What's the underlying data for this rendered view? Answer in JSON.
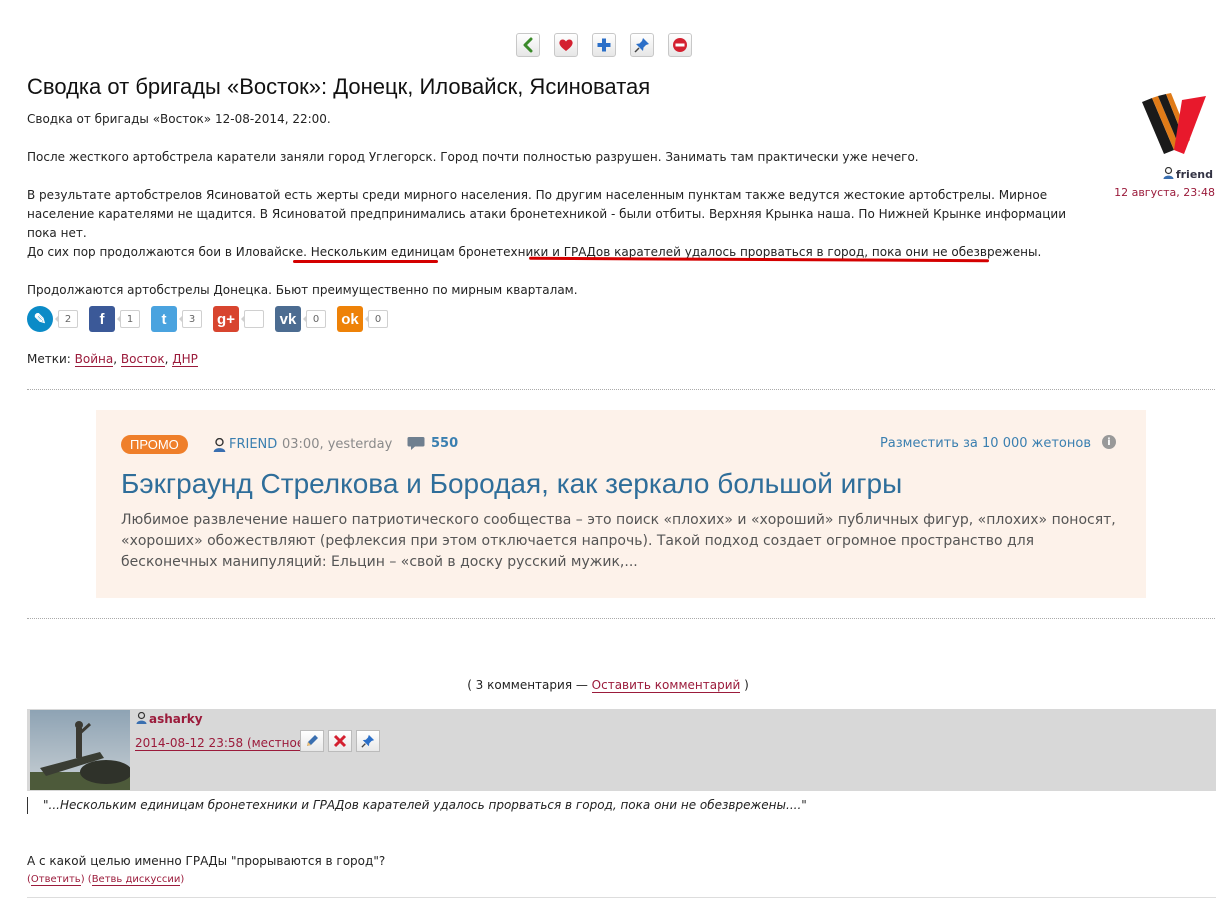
{
  "toolbar": {
    "colors": {
      "back": "#3a8a2a",
      "like": "#d42030",
      "add": "#2b6fc8",
      "pin": "#2b6fc8",
      "remove": "#d42030"
    }
  },
  "post": {
    "title": "Сводка от бригады «Восток»: Донецк, Иловайск, Ясиноватая",
    "lead": "Сводка от бригады «Восток» 12-08-2014, 22:00.",
    "p1": "После жесткого артобстрела каратели заняли город Углегорск. Город почти полностью разрушен. Занимать там практически уже нечего.",
    "p2": "В результате артобстрелов Ясиноватой есть жерты среди мирного населения. По другим населенным пунктам также ведутся жестокие артобстрелы. Мирное население карателями не щадится. В Ясиноватой предпринимались атаки бронетехникой - были отбиты. Верхняя Крынка наша. По Нижней Крынке информации пока нет.",
    "p3_a": "До сих пор продолжаются бои в Иловайске.",
    "p3_b": " Нескольким единицам",
    "p3_c": " бронетехники и ",
    "p3_d": "ГРАДов карателей удалось прорваться в город, пока они не обезврежены.",
    "p4": "Продолжаются артобстрелы Донецка. Бьют преимущественно по мирным кварталам.",
    "author": "friend",
    "date": "12 августа, 23:48"
  },
  "share": [
    {
      "icon": "livejournal-icon",
      "count": "2",
      "color": "#0b8bc7",
      "glyph": "✎"
    },
    {
      "icon": "facebook-icon",
      "count": "1",
      "color": "#3b5998",
      "glyph": "f"
    },
    {
      "icon": "twitter-icon",
      "count": "3",
      "color": "#4aa3df",
      "glyph": "t"
    },
    {
      "icon": "google-plus-icon",
      "count": "",
      "color": "#d8452f",
      "glyph": "g+"
    },
    {
      "icon": "vk-icon",
      "count": "0",
      "color": "#4c6c91",
      "glyph": "vk"
    },
    {
      "icon": "odnoklassniki-icon",
      "count": "0",
      "color": "#ee8208",
      "glyph": "ok"
    }
  ],
  "tags": {
    "label": "Метки:",
    "items": [
      "Война",
      "Восток",
      "ДНР"
    ]
  },
  "promo": {
    "badge": "ПРОМО",
    "author": "FRIEND",
    "time": "03:00, yesterday",
    "comments": "550",
    "place": "Разместить за 10 000 жетонов",
    "title": "Бэкграунд Стрелкова и Бородая, как зеркало большой игры",
    "text": "Любимое развлечение нашего патриотического сообщества – это поиск «плохих» и «хороший» публичных фигур, «плохих» поносят, «хороших» обожествляют (рефлексия при этом отключается напрочь). Такой подход создает огромное пространство для бесконечных манипуляций: Ельцин – «свой в доску русский мужик,..."
  },
  "comments_bar": {
    "open": "( 3 комментария — ",
    "link": "Оставить комментарий",
    "close": " )"
  },
  "comment": {
    "author": "asharky",
    "date": "2014-08-12 23:58 (местное)",
    "quote": "\"...Нескольким единицам бронетехники и ГРАДов карателей удалось прорваться в город, пока они не обезврежены....\"",
    "text": "А с какой целью именно ГРАДы \"прорываются в город\"?",
    "reply": "Ответить",
    "thread": "Ветвь дискуссии"
  }
}
